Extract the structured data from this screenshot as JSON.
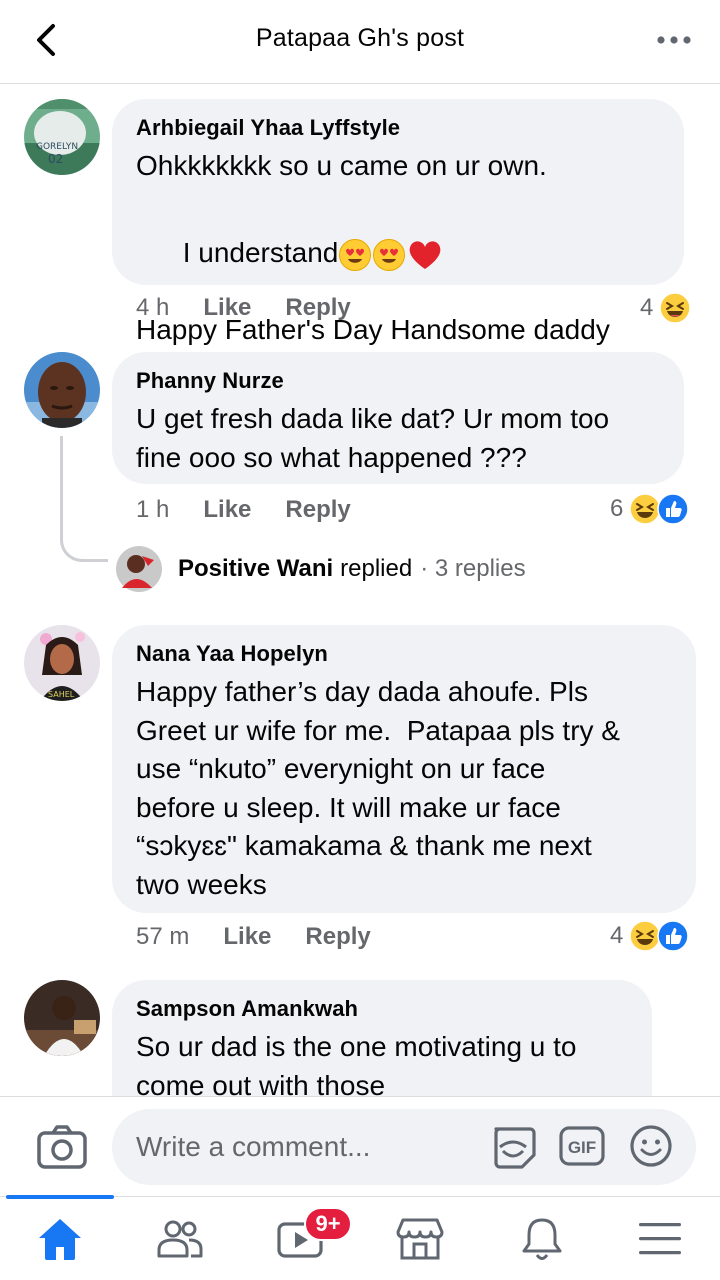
{
  "header": {
    "title": "Patapaa Gh's post"
  },
  "comments": [
    {
      "author": "Arhbiegail Yhaa Lyffstyle",
      "line1": "Ohkkkkkkk so u came on ur own.",
      "line2": "I understand",
      "line3": "Happy Father's Day Handsome daddy",
      "time": "4 h",
      "like": "Like",
      "reply": "Reply",
      "reaction_count": "4"
    },
    {
      "author": "Phanny Nurze",
      "text": "U get fresh dada like dat? Ur mom too\nfine ooo so what happened ???",
      "time": "1 h",
      "like": "Like",
      "reply": "Reply",
      "reaction_count": "6",
      "replies": {
        "name": "Positive Wani",
        "action": "replied",
        "count": "· 3 replies"
      }
    },
    {
      "author": "Nana Yaa Hopelyn",
      "text": "Happy father’s day dada ahoufe. Pls\nGreet ur wife for me.  Patapaa pls try &\nuse “nkuto” everynight on ur face\nbefore u sleep. It will make ur face\n“sɔkyɛɛ\" kamakama & thank me next\ntwo weeks",
      "time": "57 m",
      "like": "Like",
      "reply": "Reply",
      "reaction_count": "4"
    },
    {
      "author": "Sampson Amankwah",
      "text": "So ur dad is the one motivating u to\ncome out with those"
    }
  ],
  "composer": {
    "placeholder": "Write a comment..."
  },
  "nav": {
    "notifications_badge": "9+"
  },
  "colors": {
    "accent": "#1877f2",
    "bubble": "#f0f2f5",
    "muted": "#65676b",
    "badge": "#e41e3f"
  }
}
